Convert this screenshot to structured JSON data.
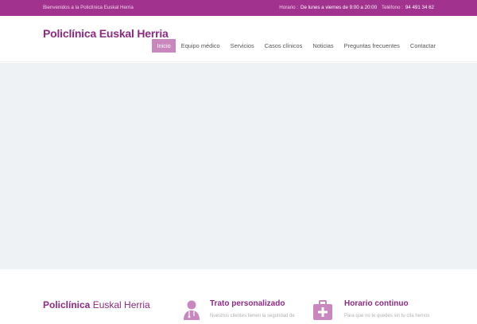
{
  "topbar": {
    "welcome": "Bienvenidos a la Policlínica Euskal Herria",
    "schedule_label": "Horario :",
    "schedule_value": "De lunes a viernes de 9:00 a 20:00",
    "phone_label": "Teléfono :",
    "phone_value": "94 491 34 62"
  },
  "header": {
    "logo": "Policlínica Euskal Herria"
  },
  "nav": {
    "items": [
      {
        "label": "Inicio"
      },
      {
        "label": "Equipo médico"
      },
      {
        "label": "Servicios"
      },
      {
        "label": "Casos clínicos"
      },
      {
        "label": "Noticias"
      },
      {
        "label": "Preguntas frecuentes"
      },
      {
        "label": "Contactar"
      }
    ]
  },
  "footer": {
    "brand_bold": "Policlínica",
    "brand_rest": " Euskal Herria",
    "features": [
      {
        "title": "Trato personalizado",
        "text": "Nuestros clientes tienen la seguridad de",
        "icon": "doctor-icon"
      },
      {
        "title": "Horario continuo",
        "text": "Para que no te quedes sin tu cita hemos",
        "icon": "medical-kit-icon"
      }
    ]
  },
  "colors": {
    "brand": "#8e2a83",
    "topbar": "#a1338f",
    "active_nav": "#c887bd",
    "hero": "#eff2f5"
  }
}
